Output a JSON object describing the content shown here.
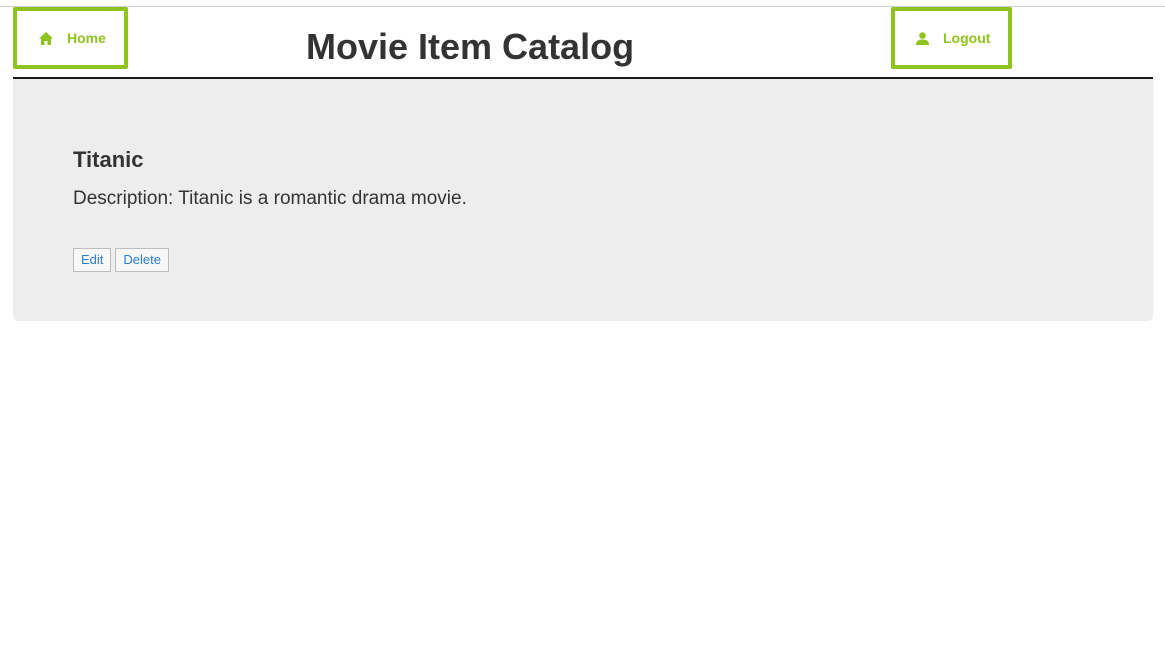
{
  "header": {
    "home_label": "Home",
    "home_icon": "home-icon",
    "title": "Movie Item Catalog",
    "logout_label": "Logout",
    "logout_icon": "user-icon"
  },
  "item": {
    "title": "Titanic",
    "description": "Description: Titanic is a romantic drama movie.",
    "edit_label": "Edit",
    "delete_label": "Delete"
  },
  "colors": {
    "accent": "#8fc31f",
    "link": "#2a7fc9",
    "panel_bg": "#ededed",
    "text": "#333333"
  }
}
